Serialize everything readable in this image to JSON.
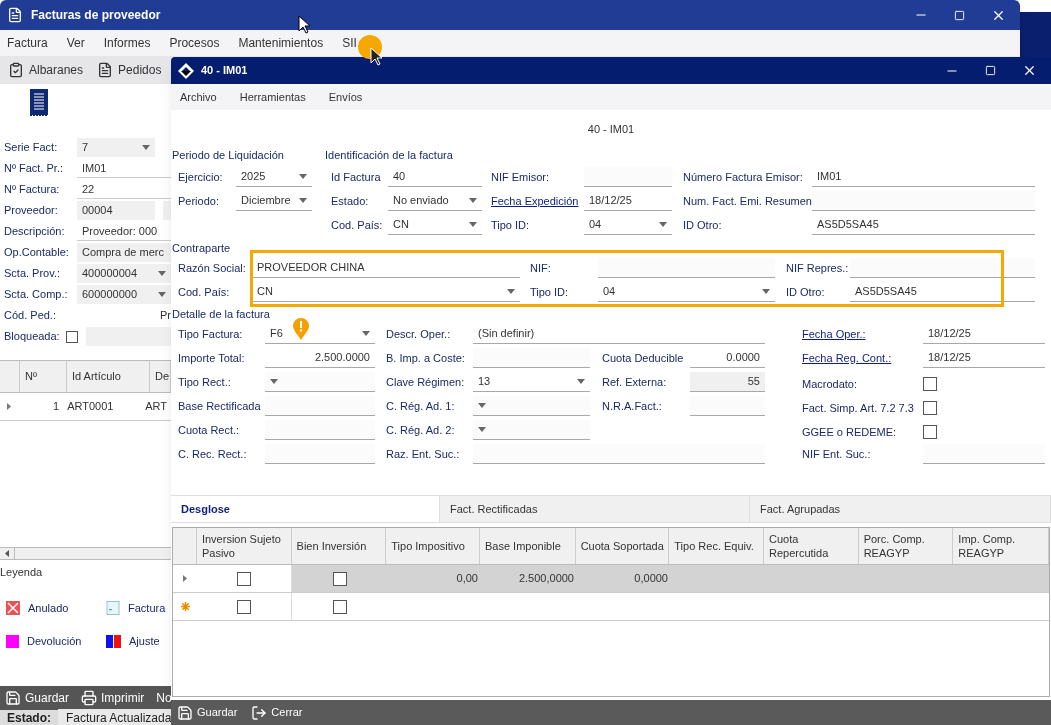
{
  "main_window": {
    "title": "Facturas de proveedor",
    "menu": [
      "Factura",
      "Ver",
      "Informes",
      "Procesos",
      "Mantenimientos",
      "SII"
    ],
    "toolbar": [
      {
        "label": "Albaranes",
        "kind": "delivery"
      },
      {
        "label": "Pedidos",
        "kind": "order"
      }
    ],
    "fields": [
      {
        "label": "Serie Fact:",
        "value": "7",
        "kind": "dropdown"
      },
      {
        "label": "Nº Fact. Pr.:",
        "value": "IM01",
        "kind": "text"
      },
      {
        "label": "Nº Factura:",
        "value": "22",
        "kind": "text"
      },
      {
        "label": "Proveedor:",
        "value": "00004",
        "kind": "split"
      },
      {
        "label": "Descripción:",
        "value": "Proveedor: 000",
        "kind": "text"
      },
      {
        "label": "Op.Contable:",
        "value": "Compra de merc",
        "kind": "readonly"
      },
      {
        "label": "Scta. Prov.:",
        "value": "400000004",
        "kind": "dropdown"
      },
      {
        "label": "Scta. Comp.:",
        "value": "600000000",
        "kind": "dropdown"
      },
      {
        "label": "Cód. Ped.:",
        "value": "Pr",
        "kind": "note"
      },
      {
        "label": "Bloqueada:",
        "kind": "checkbox",
        "checked": false
      }
    ],
    "grid": {
      "columns": [
        "Nº",
        "Id Artículo",
        "De"
      ],
      "rows": [
        [
          "1",
          "ART0001",
          "ART"
        ]
      ]
    },
    "legend": {
      "title": "Leyenda",
      "items": [
        {
          "label": "Anulado",
          "kind": "cancelled"
        },
        {
          "label": "Factura",
          "kind": "invoice"
        },
        {
          "label": "Devolución",
          "kind": "return"
        },
        {
          "label": "Ajuste",
          "kind": "adjust"
        }
      ]
    },
    "actions": [
      {
        "label": "Guardar",
        "kind": "save"
      },
      {
        "label": "Imprimir",
        "kind": "print"
      },
      {
        "label": "No",
        "kind": "plain"
      }
    ],
    "status": {
      "label": "Estado:",
      "value": "Factura Actualizada"
    }
  },
  "dialog": {
    "title": "40 - IM01",
    "menu": [
      "Archivo",
      "Herramientas",
      "Envíos"
    ],
    "heading": "40 - IM01",
    "period": {
      "title": "Periodo de Liquidación",
      "fields": [
        {
          "label": "Ejercicio:",
          "value": "2025",
          "kind": "dropdown"
        },
        {
          "label": "Periodo:",
          "value": "Diciembre",
          "kind": "dropdown"
        }
      ]
    },
    "identification": {
      "title": "Identificación de la factura",
      "rows": [
        [
          {
            "label": "Id Factura",
            "value": "40",
            "kind": "text",
            "link": false
          },
          {
            "label": "NIF Emisor:",
            "kind": "text",
            "link": false
          },
          {
            "label": "Número Factura Emisor:",
            "value": "IM01",
            "kind": "text",
            "link": false
          }
        ],
        [
          {
            "label": "Estado:",
            "value": "No enviado",
            "kind": "dropdown",
            "link": false
          },
          {
            "label": "Fecha Expedición",
            "value": "18/12/25",
            "kind": "text",
            "link": true
          },
          {
            "label": "Num. Fact. Emi. Resumen",
            "kind": "text",
            "link": false
          }
        ],
        [
          {
            "label": "Cod. País:",
            "value": "CN",
            "kind": "dropdown",
            "link": false
          },
          {
            "label": "Tipo ID:",
            "value": "04",
            "kind": "dropdown",
            "link": false
          },
          {
            "label": "ID Otro:",
            "value": "AS5D5SA45",
            "kind": "text",
            "link": false
          }
        ]
      ]
    },
    "counterpart": {
      "title": "Contraparte",
      "highlighted": true,
      "rows": [
        [
          {
            "label": "Razón Social:",
            "value": "PROVEEDOR CHINA",
            "kind": "text",
            "link": false
          },
          {
            "label": "NIF:",
            "kind": "text",
            "link": false
          },
          {
            "label": "NIF Repres.:",
            "kind": "text",
            "link": false
          }
        ],
        [
          {
            "label": "Cod. País:",
            "value": "CN",
            "kind": "dropdown",
            "link": false
          },
          {
            "label": "Tipo ID:",
            "value": "04",
            "kind": "dropdown",
            "link": false
          },
          {
            "label": "ID Otro:",
            "value": "AS5D5SA45",
            "kind": "text",
            "link": false
          }
        ]
      ]
    },
    "detail": {
      "title": "Detalle de la factura",
      "rows": [
        [
          {
            "label": "Tipo Factura:",
            "value": "F6",
            "kind": "dropdown",
            "link": false,
            "warning": true
          },
          {
            "label": "Descr. Oper.:",
            "value": "(Sin definir)",
            "kind": "wide",
            "link": false
          },
          {
            "label": "Fecha Oper.:",
            "value": "18/12/25",
            "kind": "text",
            "link": true
          }
        ],
        [
          {
            "label": "Importe Total:",
            "value": "2.500.0000",
            "kind": "number",
            "link": false
          },
          {
            "label": "B. Imp. a Coste:",
            "kind": "text",
            "link": false
          },
          {
            "label": "Cuota Deducible",
            "value": "0.0000",
            "kind": "number",
            "link": false
          },
          {
            "label": "Fecha Reg. Cont.:",
            "value": "18/12/25",
            "kind": "text",
            "link": true
          }
        ],
        [
          {
            "label": "Tipo Rect.:",
            "kind": "dropdown",
            "link": false
          },
          {
            "label": "Clave Régimen:",
            "value": "13",
            "kind": "dropdown",
            "link": false
          },
          {
            "label": "Ref. Externa:",
            "value": "55",
            "kind": "readonly",
            "link": false
          },
          {
            "label": "Macrodato:",
            "kind": "checkbox",
            "checked": false,
            "link": false
          }
        ],
        [
          {
            "label": "Base Rectificada",
            "kind": "text",
            "link": false
          },
          {
            "label": "C. Rég. Ad. 1:",
            "kind": "dropdown",
            "link": false
          },
          {
            "label": "N.R.A.Fact.:",
            "kind": "text",
            "link": false
          },
          {
            "label": "Fact. Simp. Art. 7.2 7.3",
            "kind": "checkbox",
            "checked": false,
            "link": false
          }
        ],
        [
          {
            "label": "Cuota Rect.:",
            "kind": "text",
            "link": false
          },
          {
            "label": "C. Rég. Ad. 2:",
            "kind": "dropdown",
            "link": false
          },
          {
            "kind": "blank"
          },
          {
            "label": "GGEE o REDEME:",
            "kind": "checkbox",
            "checked": false,
            "link": false
          }
        ],
        [
          {
            "label": "C. Rec. Rect.:",
            "kind": "text",
            "link": false
          },
          {
            "label": "Raz. Ent. Suc.:",
            "kind": "wide",
            "link": false
          },
          {
            "label": "NIF Ent. Suc.:",
            "kind": "text",
            "link": false
          }
        ]
      ]
    },
    "tabs": [
      {
        "label": "Desglose",
        "selected": true
      },
      {
        "label": "Fact. Rectificadas",
        "selected": false
      },
      {
        "label": "Fact. Agrupadas",
        "selected": false
      }
    ],
    "table": {
      "columns": [
        "Inversion Sujeto Pasivo",
        "Bien Inversión",
        "Tipo Impositivo",
        "Base Imponible",
        "Cuota Soportada",
        "Tipo Rec. Equiv.",
        "Cuota Repercutida",
        "Porc. Comp. REAGYP",
        "Imp. Comp. REAGYP"
      ],
      "rows": [
        {
          "kind": "data",
          "selected": true,
          "inversion_checked": false,
          "bien_checked": false,
          "values": [
            "0,00",
            "2.500,0000",
            "0,0000"
          ]
        },
        {
          "kind": "new",
          "selected": false,
          "inversion_checked": false,
          "bien_checked": false
        }
      ]
    },
    "actions": [
      {
        "label": "Guardar",
        "kind": "save"
      },
      {
        "label": "Cerrar",
        "kind": "close"
      }
    ]
  }
}
